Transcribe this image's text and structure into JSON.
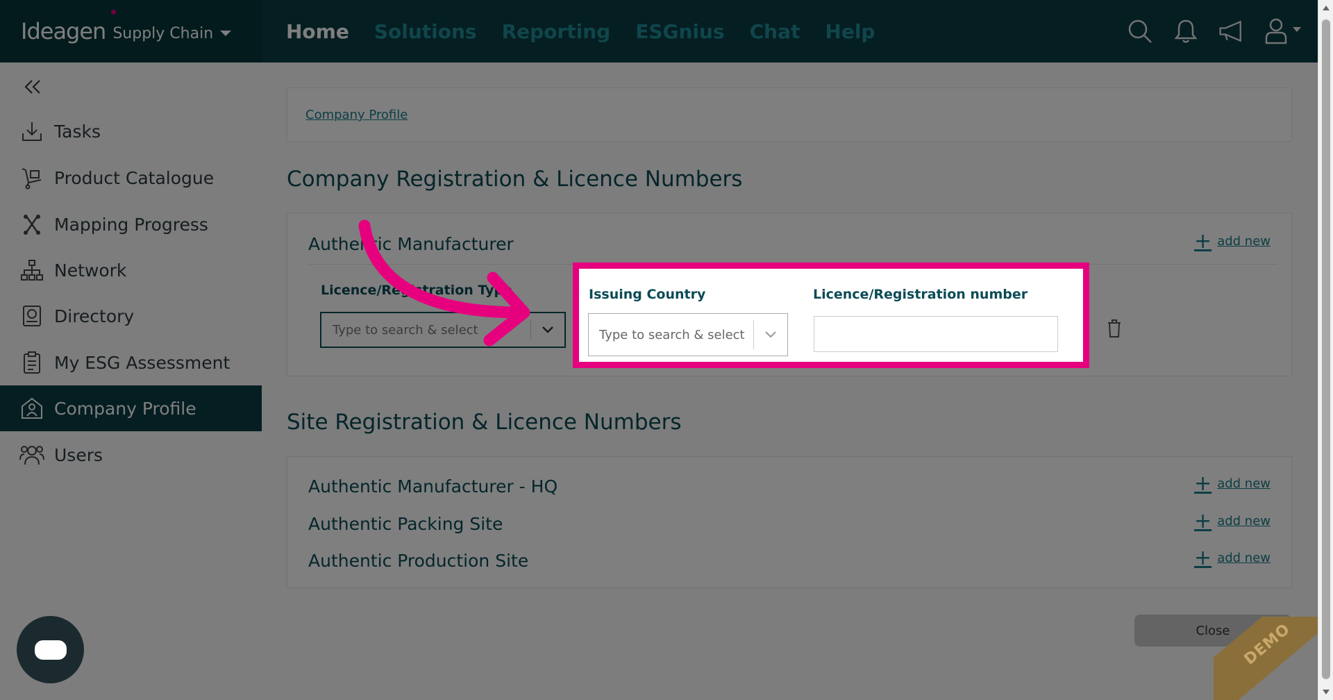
{
  "brand": {
    "name": "Ideagen",
    "product": "Supply Chain"
  },
  "nav": [
    {
      "label": "Home",
      "active": true
    },
    {
      "label": "Solutions"
    },
    {
      "label": "Reporting"
    },
    {
      "label": "ESGnius"
    },
    {
      "label": "Chat"
    },
    {
      "label": "Help"
    }
  ],
  "top_icons": [
    "search-icon",
    "bell-icon",
    "megaphone-icon",
    "user-icon"
  ],
  "sidebar": {
    "items": [
      {
        "label": "Tasks",
        "icon": "download-tray-icon"
      },
      {
        "label": "Product Catalogue",
        "icon": "trolley-icon"
      },
      {
        "label": "Mapping Progress",
        "icon": "mapping-icon"
      },
      {
        "label": "Network",
        "icon": "network-icon"
      },
      {
        "label": "Directory",
        "icon": "directory-icon"
      },
      {
        "label": "My ESG Assessment",
        "icon": "clipboard-icon"
      },
      {
        "label": "Company Profile",
        "icon": "company-icon",
        "active": true
      },
      {
        "label": "Users",
        "icon": "users-icon"
      }
    ]
  },
  "breadcrumb": {
    "link": "Company Profile"
  },
  "company_section": {
    "title": "Company Registration & Licence Numbers",
    "company_name": "Authentic Manufacturer",
    "add_new": "add new",
    "licence_type_label": "Licence/Registration Type",
    "licence_type_placeholder": "Type to search & select",
    "issuing_country_label": "Issuing Country",
    "issuing_country_placeholder": "Type to search & select",
    "licence_number_label": "Licence/Registration number",
    "licence_number_value": ""
  },
  "site_section": {
    "title": "Site Registration & Licence Numbers",
    "sites": [
      {
        "name": "Authentic Manufacturer - HQ",
        "add_new": "add new"
      },
      {
        "name": "Authentic Packing Site",
        "add_new": "add new"
      },
      {
        "name": "Authentic Production Site",
        "add_new": "add new"
      }
    ]
  },
  "close_label": "Close",
  "demo_label": "DEMO",
  "colors": {
    "header": "#0a3d42",
    "accent": "#1a7d8a",
    "highlight": "#e6007e"
  }
}
